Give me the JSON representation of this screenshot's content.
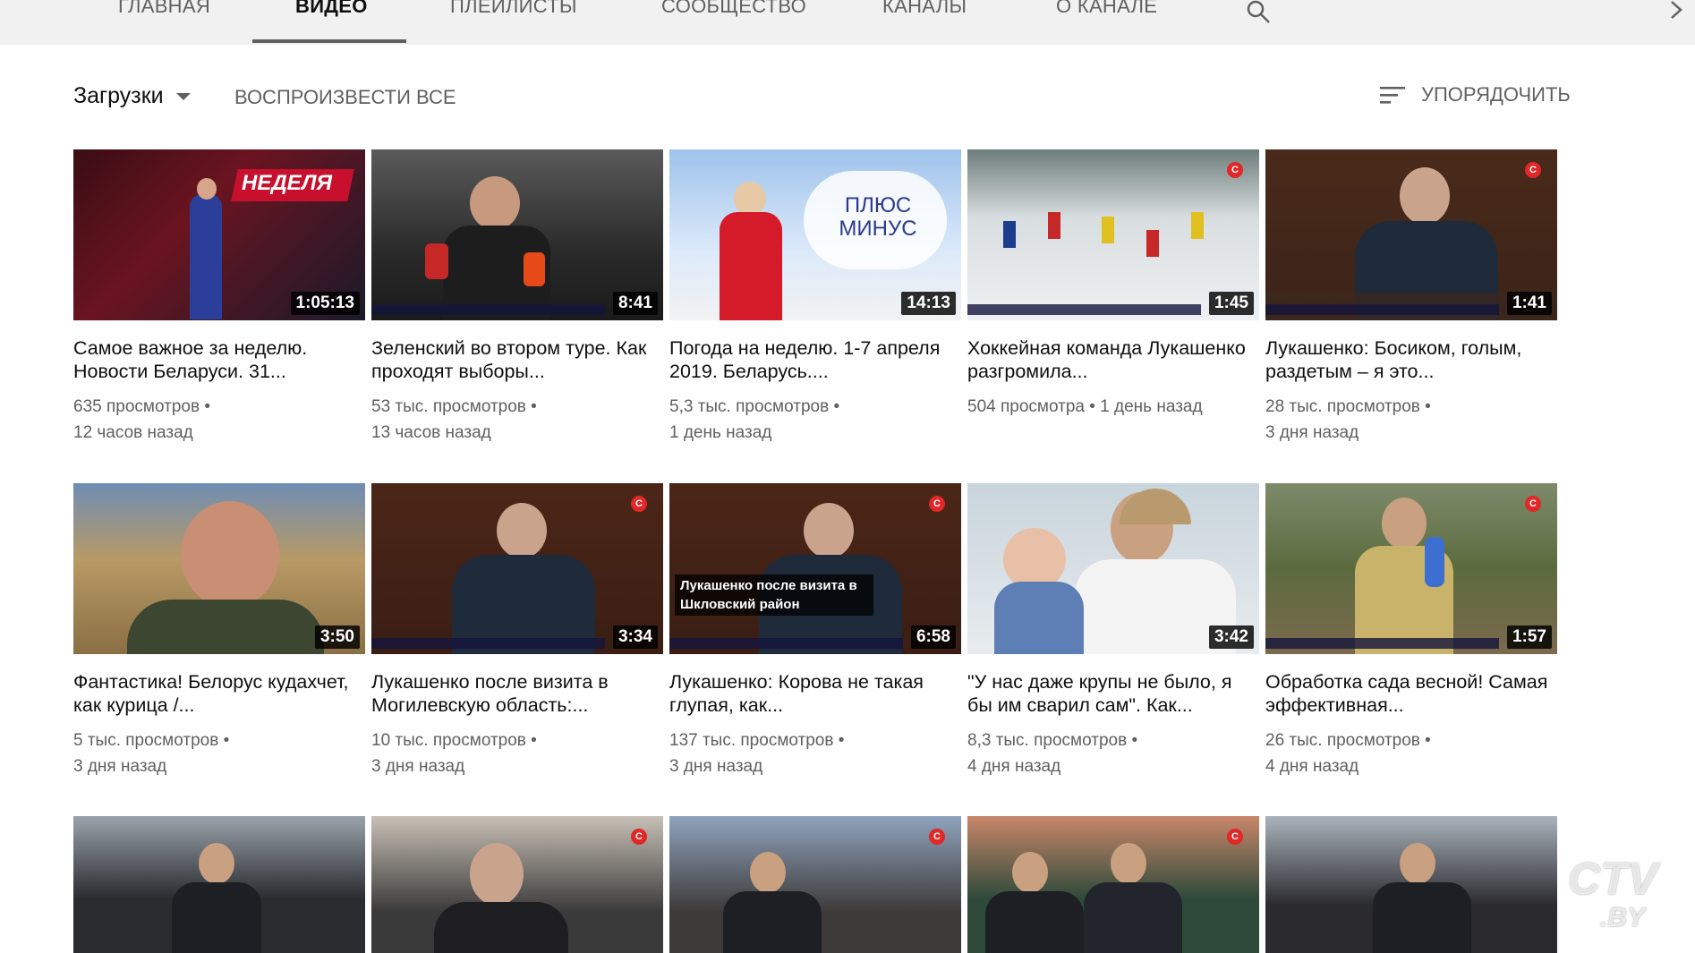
{
  "tabs": [
    {
      "label": "Главная",
      "active": false
    },
    {
      "label": "Видео",
      "active": true
    },
    {
      "label": "Плейлисты",
      "active": false
    },
    {
      "label": "Сообщество",
      "active": false
    },
    {
      "label": "Каналы",
      "active": false
    },
    {
      "label": "О канале",
      "active": false
    }
  ],
  "icons": {
    "search": "search-icon",
    "next": "chevron-right-icon",
    "sort": "sort-icon",
    "dropdown": "caret-down-icon"
  },
  "controls": {
    "uploads_label": "Загрузки",
    "play_all_label": "ВОСПРОИЗВЕСТИ ВСЕ",
    "sort_label": "УПОРЯДОЧИТЬ"
  },
  "videos": [
    {
      "title": "Самое важное за неделю. Новости Беларуси. 31...",
      "views": "635 просмотров",
      "age": "12 часов назад",
      "duration": "1:05:13",
      "thumb_text": "НЕДЕЛЯ"
    },
    {
      "title": "Зеленский во втором туре. Как проходят выборы...",
      "views": "53 тыс. просмотров",
      "age": "13 часов назад",
      "duration": "8:41",
      "thumb_text": ""
    },
    {
      "title": "Погода на неделю. 1-7 апреля 2019. Беларусь....",
      "views": "5,3 тыс. просмотров",
      "age": "1 день назад",
      "duration": "14:13",
      "thumb_text": "ПЛЮС МИНУС"
    },
    {
      "title": "Хоккейная команда Лукашенко разгромила...",
      "views": "504 просмотра",
      "age": "1 день назад",
      "duration": "1:45",
      "thumb_text": ""
    },
    {
      "title": "Лукашенко: Босиком, голым, раздетым – я это...",
      "views": "28 тыс. просмотров",
      "age": "3 дня назад",
      "duration": "1:41",
      "thumb_text": ""
    },
    {
      "title": "Фантастика! Белорус кудахчет, как курица /...",
      "views": "5 тыс. просмотров",
      "age": "3 дня назад",
      "duration": "3:50",
      "thumb_text": ""
    },
    {
      "title": "Лукашенко после визита в Могилевскую область:...",
      "views": "10 тыс. просмотров",
      "age": "3 дня назад",
      "duration": "3:34",
      "thumb_text": ""
    },
    {
      "title": "Лукашенко: Корова не такая глупая, как...",
      "views": "137 тыс. просмотров",
      "age": "3 дня назад",
      "duration": "6:58",
      "thumb_text": "Лукашенко после визита в Шкловский район"
    },
    {
      "title": "\"У нас даже крупы не было, я бы им сварил сам\". Как...",
      "views": "8,3 тыс. просмотров",
      "age": "4 дня назад",
      "duration": "3:42",
      "thumb_text": ""
    },
    {
      "title": "Обработка сада весной! Самая эффективная...",
      "views": "26 тыс. просмотров",
      "age": "4 дня назад",
      "duration": "1:57",
      "thumb_text": ""
    },
    {
      "title": "",
      "views": "",
      "age": "",
      "duration": "",
      "thumb_text": ""
    },
    {
      "title": "",
      "views": "",
      "age": "",
      "duration": "",
      "thumb_text": ""
    },
    {
      "title": "",
      "views": "",
      "age": "",
      "duration": "",
      "thumb_text": ""
    },
    {
      "title": "",
      "views": "",
      "age": "",
      "duration": "",
      "thumb_text": ""
    },
    {
      "title": "",
      "views": "",
      "age": "",
      "duration": "",
      "thumb_text": ""
    }
  ],
  "watermark": {
    "line1": "CTV",
    "line2": ".BY"
  },
  "colors": {
    "tabbar_bg": "#f1f1f1",
    "text_primary": "#0f0f0f",
    "text_secondary": "#606060",
    "duration_bg": "#000000",
    "channel_badge": "#e12727"
  }
}
